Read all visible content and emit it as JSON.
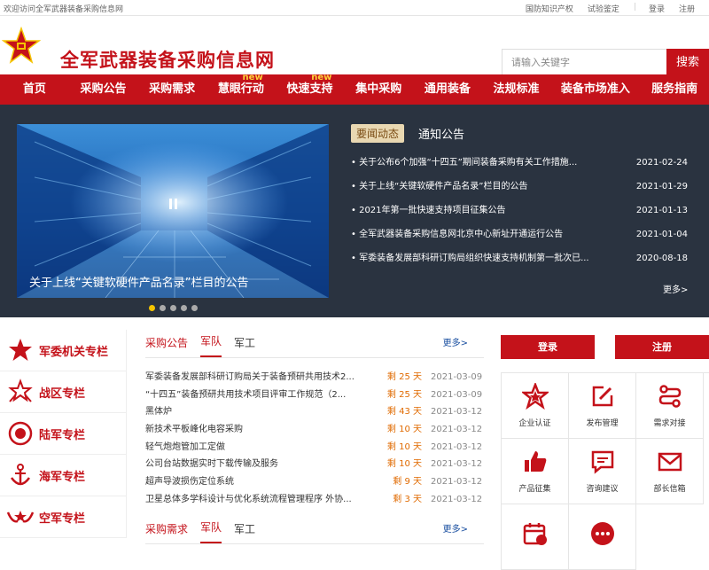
{
  "topbar": {
    "welcome": "欢迎访问全军武器装备采购信息网",
    "links": [
      "国防知识产权",
      "试验鉴定",
      "|",
      "登录",
      "注册"
    ]
  },
  "header": {
    "title": "全军武器装备采购信息网",
    "search_placeholder": "请输入关键字",
    "search_button": "搜索"
  },
  "nav": [
    {
      "label": "首页",
      "badge": ""
    },
    {
      "label": "采购公告",
      "badge": ""
    },
    {
      "label": "采购需求",
      "badge": ""
    },
    {
      "label": "慧眼行动",
      "badge": "new"
    },
    {
      "label": "快速支持",
      "badge": "new"
    },
    {
      "label": "集中采购",
      "badge": ""
    },
    {
      "label": "通用装备",
      "badge": ""
    },
    {
      "label": "法规标准",
      "badge": ""
    },
    {
      "label": "装备市场准入",
      "badge": ""
    },
    {
      "label": "服务指南",
      "badge": ""
    }
  ],
  "banner": {
    "caption": "关于上线“关键软硬件产品名录”栏目的公告",
    "dot_count": 5,
    "active_dot": 1
  },
  "news": {
    "tab_active": "要闻动态",
    "tab_other": "通知公告",
    "items": [
      {
        "title": "• 关于公布6个加强“十四五”期间装备采购有关工作措施...",
        "date": "2021-02-24"
      },
      {
        "title": "• 关于上线“关键软硬件产品名录”栏目的公告",
        "date": "2021-01-29"
      },
      {
        "title": "• 2021年第一批快速支持项目征集公告",
        "date": "2021-01-13"
      },
      {
        "title": "• 全军武器装备采购信息网北京中心新址开通运行公告",
        "date": "2021-01-04"
      },
      {
        "title": "• 军委装备发展部科研订购局组织快速支持机制第一批次已...",
        "date": "2020-08-18"
      }
    ],
    "more": "更多>"
  },
  "sidebar": [
    {
      "label": "军委机关专栏",
      "icon": "star-icon"
    },
    {
      "label": "战区专栏",
      "icon": "theater-emblem-icon"
    },
    {
      "label": "陆军专栏",
      "icon": "army-emblem-icon"
    },
    {
      "label": "海军专栏",
      "icon": "anchor-icon"
    },
    {
      "label": "空军专栏",
      "icon": "wings-icon"
    }
  ],
  "procurement": {
    "tabs": [
      "采购公告",
      "军队",
      "军工"
    ],
    "more": "更多>",
    "items": [
      {
        "title": "军委装备发展部科研订购局关于装备预研共用技术2...",
        "remain": "剩 25 天",
        "date": "2021-03-09"
      },
      {
        "title": "“十四五”装备预研共用技术项目评审工作规范（2...",
        "remain": "剩 25 天",
        "date": "2021-03-09"
      },
      {
        "title": "黑体炉",
        "remain": "剩 43 天",
        "date": "2021-03-12"
      },
      {
        "title": "新技术平板峰化电容采购",
        "remain": "剩 10 天",
        "date": "2021-03-12"
      },
      {
        "title": "轻气炮炮管加工定做",
        "remain": "剩 10 天",
        "date": "2021-03-12"
      },
      {
        "title": "公司台站数据实时下载传输及服务",
        "remain": "剩 10 天",
        "date": "2021-03-12"
      },
      {
        "title": "超声导波损伤定位系统",
        "remain": "剩 9 天",
        "date": "2021-03-12"
      },
      {
        "title": "卫星总体多学科设计与优化系统流程管理程序 外协...",
        "remain": "剩 3 天",
        "date": "2021-03-12"
      }
    ]
  },
  "demand": {
    "tabs": [
      "采购需求",
      "军队",
      "军工"
    ],
    "more": "更多>"
  },
  "auth": {
    "login": "登录",
    "register": "注册"
  },
  "services": [
    {
      "label": "企业认证",
      "icon": "badge-star-icon"
    },
    {
      "label": "发布管理",
      "icon": "edit-icon"
    },
    {
      "label": "需求对接",
      "icon": "link-icon"
    },
    {
      "label": "产品征集",
      "icon": "thumbs-up-icon"
    },
    {
      "label": "咨询建议",
      "icon": "chat-icon"
    },
    {
      "label": "部长信箱",
      "icon": "mail-icon"
    },
    {
      "label": "",
      "icon": "calendar-icon"
    },
    {
      "label": "",
      "icon": "more-icon"
    }
  ],
  "colors": {
    "brand": "#c4121a",
    "dark_panel": "#2a3340",
    "accent_yellow": "#f5c400"
  }
}
